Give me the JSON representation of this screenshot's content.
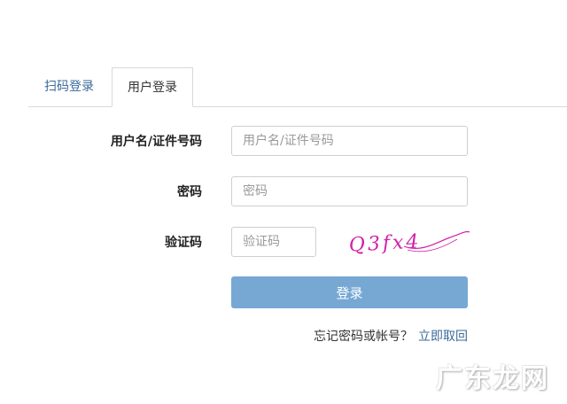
{
  "tabs": [
    {
      "label": "扫码登录"
    },
    {
      "label": "用户登录",
      "active": true
    }
  ],
  "form": {
    "username_label": "用户名/证件号码",
    "username_placeholder": "用户名/证件号码",
    "password_label": "密码",
    "password_placeholder": "密码",
    "captcha_label": "验证码",
    "captcha_placeholder": "验证码",
    "captcha_text": "Q3fx4",
    "submit_label": "登录"
  },
  "footer": {
    "question": "忘记密码或帐号？",
    "link": "立即取回"
  },
  "watermark": "广东龙网",
  "colors": {
    "accent": "#3a6a9a",
    "button": "#77a8d4",
    "captcha_ink": "#d020a8"
  }
}
